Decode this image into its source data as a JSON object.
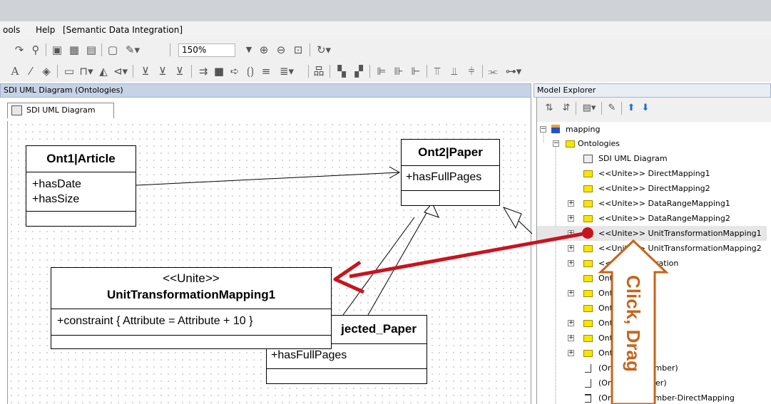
{
  "menu": {
    "tools": "ools",
    "help": "Help",
    "plugin": "[Semantic Data Integration]"
  },
  "toolbar": {
    "zoom": "150%"
  },
  "diagram_panel": {
    "title": "SDI UML Diagram (Ontologies)",
    "tab_label": "SDI UML Diagram"
  },
  "classes": {
    "article": {
      "name": "Ont1|Article",
      "attrs": [
        "+hasDate",
        "+hasSize"
      ]
    },
    "paper": {
      "name": "Ont2|Paper",
      "attrs": [
        "+hasFullPages"
      ]
    },
    "mapping": {
      "stereotype": "<<Unite>>",
      "name": "UnitTransformationMapping1",
      "attrs": [
        "+constraint { Attribute = Attribute + 10 }"
      ]
    },
    "rejected": {
      "name": "jected_Paper",
      "attrs": [
        "+hasFullPages"
      ]
    }
  },
  "explorer": {
    "title": "Model Explorer",
    "tree": [
      {
        "label": "mapping"
      },
      {
        "label": "Ontologies"
      },
      {
        "label": "SDI UML Diagram"
      },
      {
        "label": "<<Unite>> DirectMapping1"
      },
      {
        "label": "<<Unite>> DirectMapping2"
      },
      {
        "label": "<<Unite>> DataRangeMapping1"
      },
      {
        "label": "<<Unite>> DataRangeMapping2"
      },
      {
        "label": "<<Unite>> UnitTransformationMapping1"
      },
      {
        "label": "<<Unite>> UnitTransformationMapping2"
      },
      {
        "label": "<<Unite>> ...ration"
      },
      {
        "label": "Ont1|..."
      },
      {
        "label": "Ont1|Art..."
      },
      {
        "label": "Ont2|Me..."
      },
      {
        "label": "Ont2|Pa...r"
      },
      {
        "label": "Ont2|Re...per"
      },
      {
        "label": "Ont2|Ac...per"
      },
      {
        "label": "(Ont1|Pe...|Member)"
      },
      {
        "label": "(Ont1|Ar...|Paper)"
      },
      {
        "label": "(Ont1|Pe...|Member-DirectMapping"
      }
    ]
  },
  "annotation": {
    "text": "Click, Drag"
  },
  "colors": {
    "arrow": "#c8141e",
    "callout": "#c8641a"
  }
}
